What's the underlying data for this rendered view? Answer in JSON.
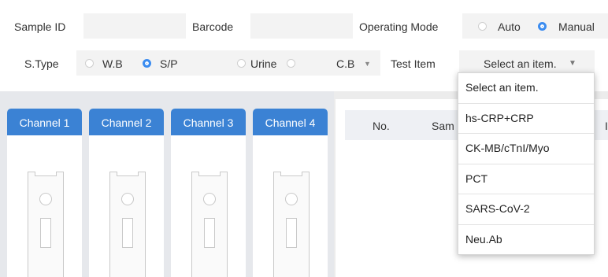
{
  "form": {
    "sample_id_label": "Sample ID",
    "sample_id_value": "",
    "barcode_label": "Barcode",
    "barcode_value": "",
    "operating_mode_label": "Operating Mode",
    "mode_auto": "Auto",
    "mode_manual": "Manual",
    "mode_selected": "Manual",
    "stype_label": "S.Type",
    "stype_wb": "W.B",
    "stype_sp": "S/P",
    "stype_urine": "Urine",
    "stype_cb": "C.B",
    "stype_selected": "S/P",
    "test_item_label": "Test Item",
    "test_item_value": "Select an item."
  },
  "dropdown": {
    "items": [
      "Select an item.",
      "hs-CRP+CRP",
      "CK-MB/cTnI/Myo",
      "PCT",
      "SARS-CoV-2",
      "Neu.Ab"
    ]
  },
  "channels": [
    "Channel 1",
    "Channel 2",
    "Channel 3",
    "Channel 4"
  ],
  "table": {
    "col_no": "No.",
    "col_sample_partial": "Sam",
    "col_partial_right": "I"
  },
  "colors": {
    "accent": "#3b82d4",
    "radio_selected": "#3b8cf0"
  }
}
